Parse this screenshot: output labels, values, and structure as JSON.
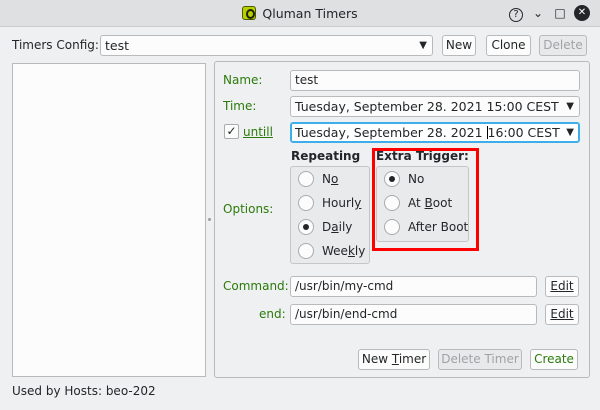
{
  "window": {
    "title": "Qluman Timers"
  },
  "titlebar_buttons": {
    "help": "?",
    "minimize": "⌄",
    "maximize": "□",
    "close": "✕"
  },
  "config": {
    "label": "Timers Config:",
    "value": "test",
    "new_label": "New",
    "clone_label": "Clone",
    "delete_label": "Delete"
  },
  "form": {
    "name_label": "Name:",
    "name_value": "test",
    "time_label": "Time:",
    "time_value": "Tuesday, September 28. 2021 15:00 CEST",
    "untill_label": "untill",
    "untill_checked": true,
    "untill_value_before_caret": "Tuesday, September 28. 2021 ",
    "untill_value_after_caret": "16:00 CEST",
    "options_label": "Options:",
    "repeating": {
      "title": "Repeating",
      "options": [
        {
          "label": "No",
          "checked": false
        },
        {
          "label": "Hourly",
          "checked": false
        },
        {
          "label": "Daily",
          "checked": true
        },
        {
          "label": "Weekly",
          "checked": false
        }
      ]
    },
    "extra_trigger": {
      "title": "Extra Trigger:",
      "options": [
        {
          "label": "No",
          "checked": true
        },
        {
          "label": "At Boot",
          "checked": false
        },
        {
          "label": "After Boot",
          "checked": false
        }
      ]
    },
    "command_label": "Command:",
    "command_value": "/usr/bin/my-cmd",
    "command_edit": "Edit",
    "end_label": "end:",
    "end_value": "/usr/bin/end-cmd",
    "end_edit": "Edit",
    "new_timer_label": "New Timer",
    "delete_timer_label": "Delete Timer",
    "create_label": "Create"
  },
  "status": {
    "used_by": "Used by Hosts: beo-202"
  },
  "colors": {
    "label_green": "#2b7a0b",
    "highlight_red": "#ff0000",
    "focus_blue": "#3daee9"
  }
}
